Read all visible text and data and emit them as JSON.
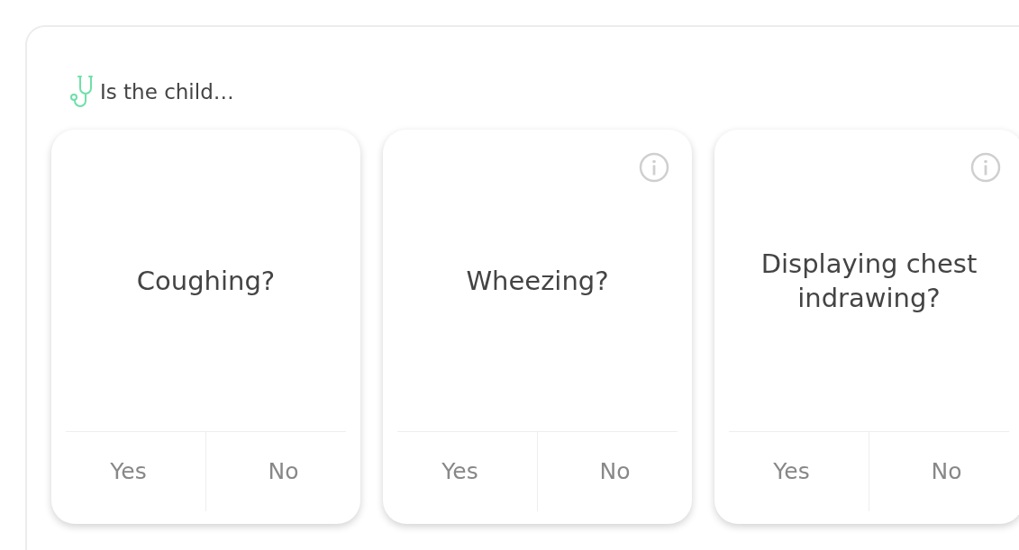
{
  "prompt": "Is the child…",
  "questions": [
    {
      "text": "Coughing?",
      "has_info": false,
      "options": [
        "Yes",
        "No"
      ]
    },
    {
      "text": "Wheezing?",
      "has_info": true,
      "options": [
        "Yes",
        "No"
      ]
    },
    {
      "text": "Displaying chest indrawing?",
      "has_info": true,
      "options": [
        "Yes",
        "No"
      ]
    }
  ]
}
